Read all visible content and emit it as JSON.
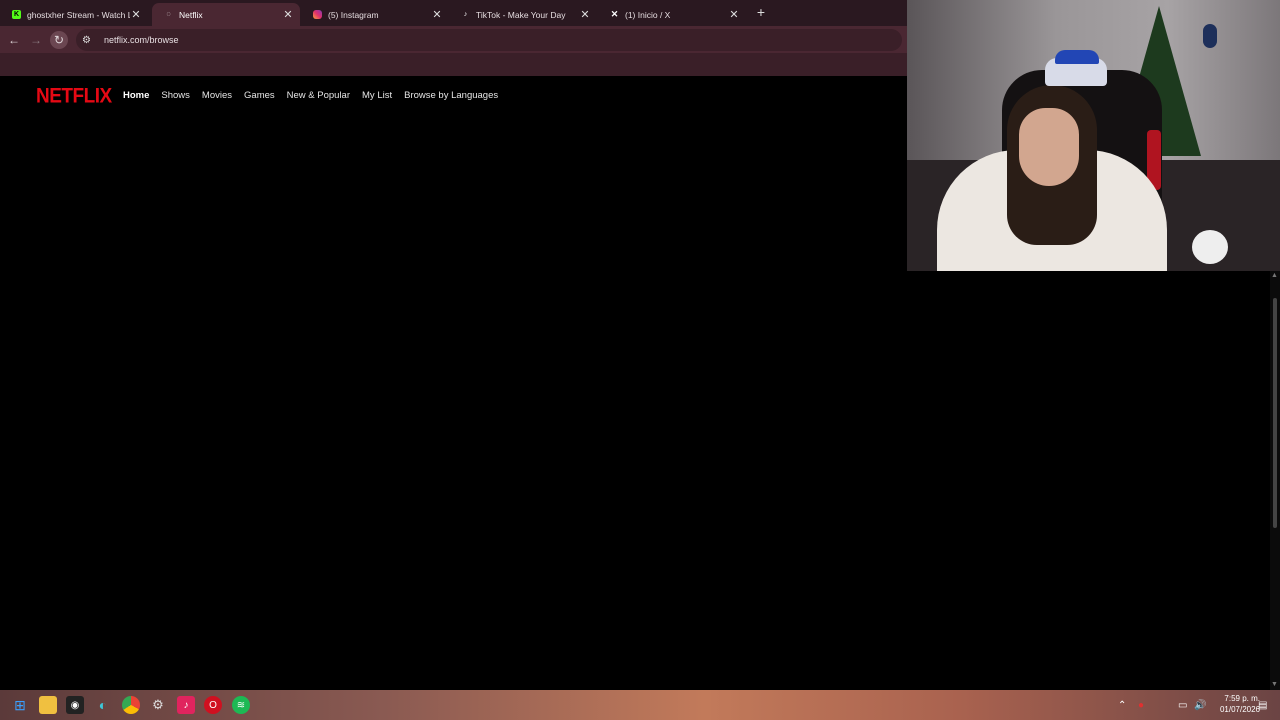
{
  "browser": {
    "tabs": [
      {
        "title": "ghostxher Stream - Watch Live",
        "favicon": "kick-icon",
        "color": "#53fc18",
        "active": false
      },
      {
        "title": "Netflix",
        "favicon": "netflix-loading-icon",
        "color": "#ffffff",
        "active": true
      },
      {
        "title": "(5) Instagram",
        "favicon": "instagram-icon",
        "color": "#e1306c",
        "active": false
      },
      {
        "title": "TikTok - Make Your Day",
        "favicon": "tiktok-icon",
        "color": "#ffffff",
        "active": false
      },
      {
        "title": "(1) Inicio / X",
        "favicon": "x-icon",
        "color": "#ffffff",
        "active": false
      }
    ],
    "new_tab_label": "+",
    "url": "netflix.com/browse"
  },
  "netflix": {
    "logo": "NETFLIX",
    "brand_color": "#e50914",
    "nav": [
      {
        "label": "Home",
        "active": true
      },
      {
        "label": "Shows",
        "active": false
      },
      {
        "label": "Movies",
        "active": false
      },
      {
        "label": "Games",
        "active": false
      },
      {
        "label": "New & Popular",
        "active": false
      },
      {
        "label": "My List",
        "active": false
      },
      {
        "label": "Browse by Languages",
        "active": false
      }
    ]
  },
  "taskbar": {
    "apps": [
      "windows-start-icon",
      "file-explorer-icon",
      "obs-icon",
      "edge-icon",
      "chrome-icon",
      "steam-icon",
      "tiktok-icon",
      "opera-icon",
      "spotify-icon"
    ],
    "clock_time": "7:59 p. m.",
    "clock_date": "01/07/2026"
  }
}
